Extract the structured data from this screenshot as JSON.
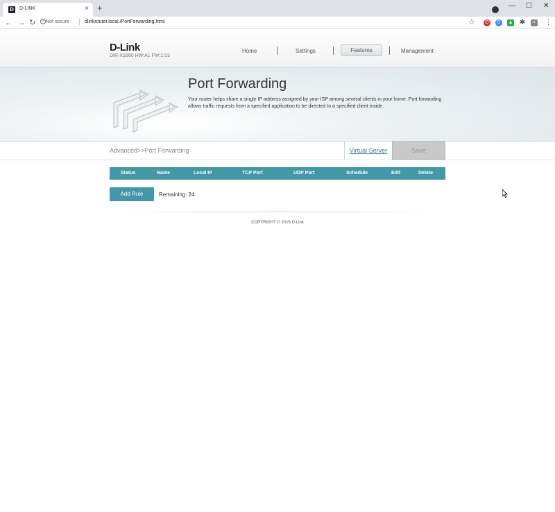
{
  "browser": {
    "tab_title": "D-LINK",
    "tab_favicon": "D",
    "new_tab": "+",
    "tab_close": "×",
    "window_minimize": "—",
    "window_maximize": "☐",
    "window_close": "✕",
    "security_label": "Not secure",
    "url": "dlinkrouter.local./PortForwarding.html",
    "back": "←",
    "forward": "→",
    "reload": "↻",
    "star": "☆",
    "menu": "⋮"
  },
  "header": {
    "logo": "D-Link",
    "model": "DIR-X1860 HW:A1 FW:1.03",
    "nav": {
      "home": "Home",
      "settings": "Settings",
      "features": "Features",
      "management": "Management"
    }
  },
  "banner": {
    "title": "Port Forwarding",
    "description": "Your router helps share a single IP address assigned by your ISP among several clients in your home. Port forwarding allows traffic requests from a specified application to be directed to a specified client inside."
  },
  "subheader": {
    "breadcrumb": "Advanced>>Port Forwarding",
    "virtual_server_link": "Virtual Server",
    "save_label": "Save"
  },
  "table": {
    "columns": {
      "status": "Status",
      "name": "Name",
      "local_ip": "Local IP",
      "tcp_port": "TCP Port",
      "udp_port": "UDP Port",
      "schedule": "Schedule",
      "edit": "Edit",
      "delete": "Delete"
    },
    "rows": []
  },
  "actions": {
    "add_rule_label": "Add Rule",
    "remaining_label": "Remaining:",
    "remaining_value": "24"
  },
  "footer": {
    "copyright": "COPYRIGHT © 2016 D-Link"
  },
  "colors": {
    "accent": "#4397a6",
    "link": "#3a7f95",
    "save_disabled": "#c9c9c9"
  }
}
